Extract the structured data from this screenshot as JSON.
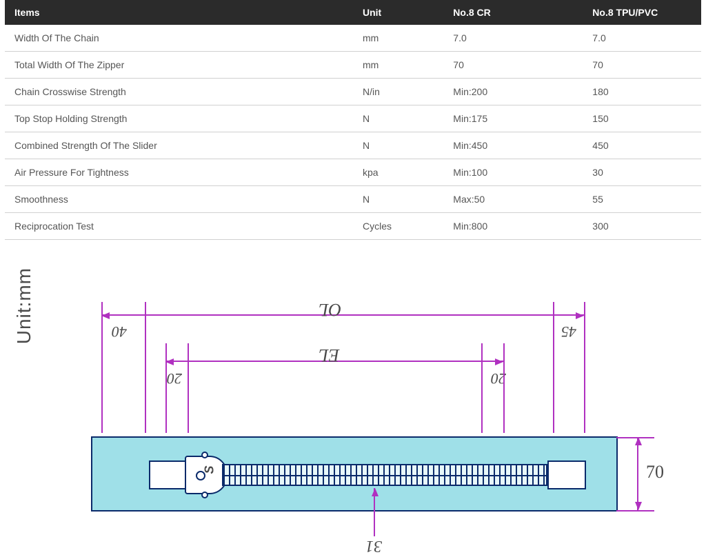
{
  "table": {
    "headers": [
      "Items",
      "Unit",
      "No.8 CR",
      "No.8 TPU/PVC"
    ],
    "rows": [
      [
        "Width Of The Chain",
        "mm",
        "7.0",
        "7.0"
      ],
      [
        "Total Width Of The Zipper",
        "mm",
        "70",
        "70"
      ],
      [
        "Chain Crosswise Strength",
        "N/in",
        "Min:200",
        "180"
      ],
      [
        "Top Stop Holding Strength",
        "N",
        "Min:175",
        "150"
      ],
      [
        "Combined Strength Of The Slider",
        "N",
        "Min:450",
        "450"
      ],
      [
        "Air Pressure For Tightness",
        "kpa",
        "Min:100",
        "30"
      ],
      [
        "Smoothness",
        "N",
        "Max:50",
        "55"
      ],
      [
        "Reciprocation Test",
        "Cycles",
        "Min:800",
        "300"
      ]
    ]
  },
  "diagram": {
    "unit_label": "Unit:mm",
    "dims": {
      "ol": "OL",
      "el": "EL",
      "left_margin": "40",
      "right_margin": "45",
      "left_gap": "20",
      "right_gap": "20",
      "tape_width": "70",
      "chain_offset": "31",
      "slider_mark": "S"
    }
  }
}
